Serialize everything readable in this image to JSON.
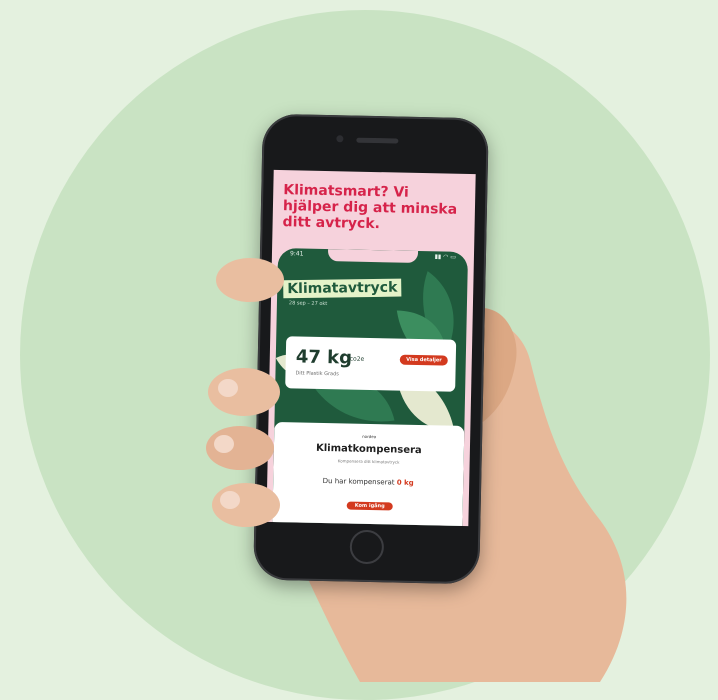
{
  "promo": {
    "headline": "Klimatsmart? Vi hjälper dig att minska ditt avtryck."
  },
  "status_bar": {
    "time": "9:41",
    "icons": "▮▮ ◠ ▭"
  },
  "app": {
    "title": "Klimatavtryck",
    "date_range": "28 sep – 27 okt",
    "summary_card": {
      "value": "47 kg",
      "unit": "co2e",
      "subtitle": "Ditt Plastik Grads",
      "details_button": "Visa detaljer"
    },
    "compensation": {
      "brand": "nordea",
      "title": "Klimatkompensera",
      "subtitle": "Kompensera ditt klimatavtryck",
      "status_prefix": "Du har kompenserat ",
      "status_value": "0 kg",
      "start_button": "Kom igång"
    }
  },
  "colors": {
    "background": "#e4f1df",
    "circle": "#c9e3c3",
    "promo_text": "#d6234a",
    "app_green": "#1f5a3c",
    "accent_red": "#d33a1f"
  }
}
